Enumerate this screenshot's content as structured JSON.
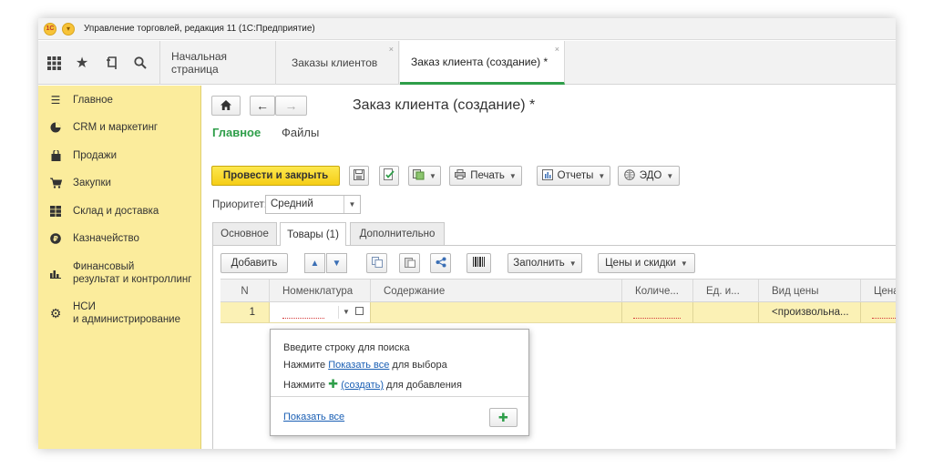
{
  "app": {
    "title": "Управление торговлей, редакция 11  (1С:Предприятие)",
    "logo_text": "1С"
  },
  "toolbar": {
    "icons": [
      "apps-grid-icon",
      "star-icon",
      "history-icon",
      "search-icon"
    ],
    "tabs": [
      {
        "label": "Начальная страница",
        "closable": false,
        "active": false
      },
      {
        "label": "Заказы клиентов",
        "closable": true,
        "active": false
      },
      {
        "label": "Заказ клиента (создание) *",
        "closable": true,
        "active": true
      }
    ]
  },
  "sidebar": {
    "items": [
      {
        "label": "Главное",
        "icon": "list-icon"
      },
      {
        "label": "CRM и маркетинг",
        "icon": "pie-chart-icon"
      },
      {
        "label": "Продажи",
        "icon": "shopping-bag-icon"
      },
      {
        "label": "Закупки",
        "icon": "cart-icon"
      },
      {
        "label": "Склад и доставка",
        "icon": "warehouse-icon"
      },
      {
        "label": "Казначейство",
        "icon": "coin-icon"
      },
      {
        "label": "Финансовый\nрезультат и контроллинг",
        "icon": "bar-chart-icon"
      },
      {
        "label": "НСИ\nи администрирование",
        "icon": "gear-icon"
      }
    ]
  },
  "form": {
    "title": "Заказ клиента (создание) *",
    "sections": {
      "main": "Главное",
      "files": "Файлы"
    },
    "buttons": {
      "post_close": "Провести и закрыть",
      "print": "Печать",
      "reports": "Отчеты",
      "edo": "ЭДО"
    },
    "priority": {
      "label": "Приоритет:",
      "value": "Средний"
    },
    "tabs": [
      "Основное",
      "Товары (1)",
      "Дополнительно"
    ],
    "goods": {
      "add": "Добавить",
      "fill": "Заполнить",
      "prices": "Цены и скидки",
      "columns": [
        "N",
        "Номенклатура",
        "Содержание",
        "Количе...",
        "Ед. и...",
        "Вид цены",
        "Цена"
      ],
      "rows": [
        {
          "n": "1",
          "nomenclature": "",
          "content": "",
          "qty": "",
          "unit": "",
          "price_type": "<произвольна...",
          "price": ""
        }
      ]
    },
    "popup": {
      "line1": "Введите строку для поиска",
      "line2_pre": "Нажмите ",
      "line2_link": "Показать все",
      "line2_post": " для выбора",
      "line3_pre": "Нажмите ",
      "line3_link": "(создать)",
      "line3_post": " для добавления",
      "show_all": "Показать все"
    }
  },
  "colors": {
    "accent_green": "#2e9e49",
    "sidebar_bg": "#fbec9c",
    "primary_button": "#f5cd16",
    "selected_row": "#fbf1b5"
  }
}
